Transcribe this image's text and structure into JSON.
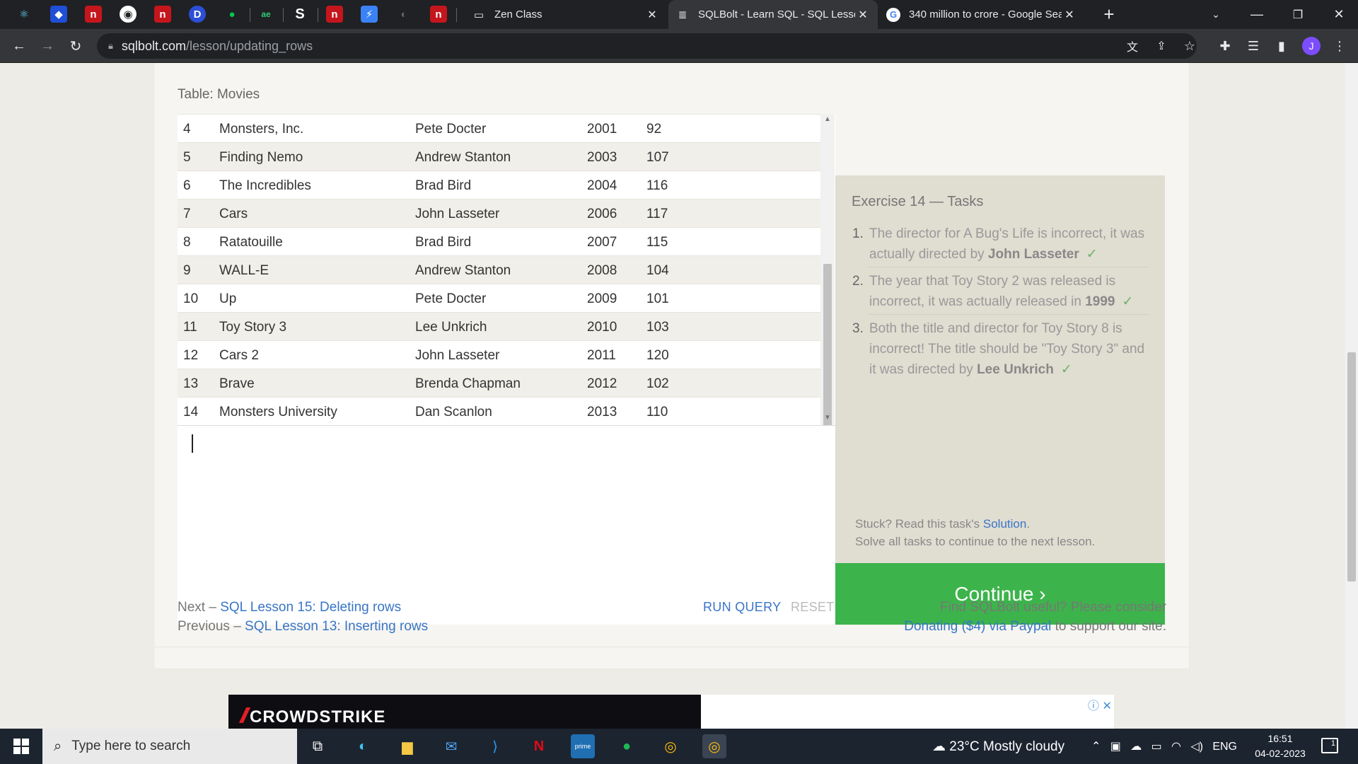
{
  "browser": {
    "pinned_tabs": [
      "react-icon",
      "shield-icon",
      "n-icon",
      "globe-icon",
      "n-icon",
      "d-icon",
      "leaf-icon",
      "ae-icon",
      "s-icon",
      "n-icon",
      "bolt-icon",
      "github-icon",
      "n-icon"
    ],
    "tabs": [
      {
        "title": "Zen Class",
        "active": false
      },
      {
        "title": "SQLBolt - Learn SQL - SQL Lessor",
        "active": true
      },
      {
        "title": "340 million to crore - Google Sea",
        "active": false
      }
    ],
    "new_tab_label": "+",
    "url_host": "sqlbolt.com",
    "url_path": "/lesson/updating_rows",
    "profile_initial": "J"
  },
  "page": {
    "table_caption": "Table: Movies",
    "rows": [
      {
        "id": "4",
        "title": "Monsters, Inc.",
        "director": "Pete Docter",
        "year": "2001",
        "length": "92"
      },
      {
        "id": "5",
        "title": "Finding Nemo",
        "director": "Andrew Stanton",
        "year": "2003",
        "length": "107"
      },
      {
        "id": "6",
        "title": "The Incredibles",
        "director": "Brad Bird",
        "year": "2004",
        "length": "116"
      },
      {
        "id": "7",
        "title": "Cars",
        "director": "John Lasseter",
        "year": "2006",
        "length": "117"
      },
      {
        "id": "8",
        "title": "Ratatouille",
        "director": "Brad Bird",
        "year": "2007",
        "length": "115"
      },
      {
        "id": "9",
        "title": "WALL-E",
        "director": "Andrew Stanton",
        "year": "2008",
        "length": "104"
      },
      {
        "id": "10",
        "title": "Up",
        "director": "Pete Docter",
        "year": "2009",
        "length": "101"
      },
      {
        "id": "11",
        "title": "Toy Story 3",
        "director": "Lee Unkrich",
        "year": "2010",
        "length": "103"
      },
      {
        "id": "12",
        "title": "Cars 2",
        "director": "John Lasseter",
        "year": "2011",
        "length": "120"
      },
      {
        "id": "13",
        "title": "Brave",
        "director": "Brenda Chapman",
        "year": "2012",
        "length": "102"
      },
      {
        "id": "14",
        "title": "Monsters University",
        "director": "Dan Scanlon",
        "year": "2013",
        "length": "110"
      }
    ],
    "run_query_label": "RUN QUERY",
    "reset_label": "RESET",
    "exercise_title": "Exercise 14 — Tasks",
    "tasks": [
      {
        "num": "1.",
        "text": "The director for A Bug's Life is incorrect, it was actually directed by ",
        "bold": "John Lasseter",
        "check": "✓"
      },
      {
        "num": "2.",
        "text": "The year that Toy Story 2 was released is incorrect, it was actually released in ",
        "bold": "1999",
        "check": "✓"
      },
      {
        "num": "3.",
        "text": "Both the title and director for Toy Story 8 is incorrect! The title should be \"Toy Story 3\" and it was directed by ",
        "bold": "Lee Unkrich",
        "check": "✓"
      }
    ],
    "stuck_prefix": "Stuck? Read this task's ",
    "solution_link": "Solution",
    "stuck_suffix": ".",
    "solve_text": "Solve all tasks to continue to the next lesson.",
    "continue_label": "Continue ›",
    "next_prefix": "Next – ",
    "next_link": "SQL Lesson 15: Deleting rows",
    "prev_prefix": "Previous – ",
    "prev_link": "SQL Lesson 13: Inserting rows",
    "useful_text": "Find SQLBolt useful? Please consider",
    "donate_link": "Donating ($4) via Paypal",
    "donate_suffix": " to support our site.",
    "ad_brand": "CROWDSTRIKE"
  },
  "taskbar": {
    "search_placeholder": "Type here to search",
    "weather": "23°C  Mostly cloudy",
    "lang": "ENG",
    "time": "16:51",
    "date": "04-02-2023",
    "notif_count": "1"
  },
  "colors": {
    "accent_green": "#3cb44b",
    "link_blue": "#3875c6",
    "page_bg": "#eeece6"
  }
}
